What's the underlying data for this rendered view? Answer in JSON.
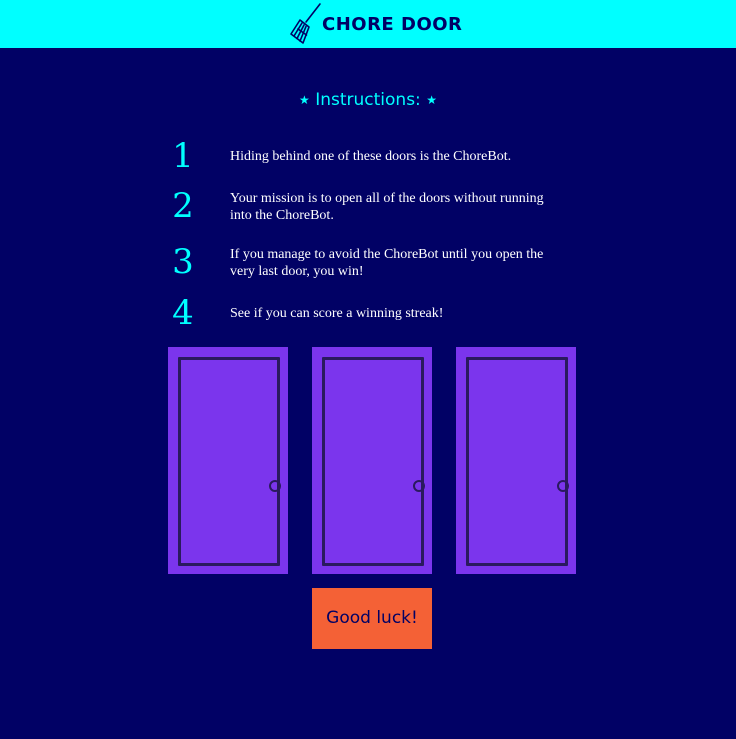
{
  "header": {
    "logo_icon": "broom-icon",
    "title": "CHORE DOOR",
    "background_color": "#00ffff"
  },
  "instructions": {
    "title": "Instructions:",
    "star_icon": "star-icon",
    "items": [
      {
        "number": "1",
        "text": "Hiding behind one of these doors is the ChoreBot."
      },
      {
        "number": "2",
        "text": "Your mission is to open all of the doors without running into the ChoreBot."
      },
      {
        "number": "3",
        "text": "If you manage to avoid the ChoreBot until you open the very last door, you win!"
      },
      {
        "number": "4",
        "text": "See if you can score a winning streak!"
      }
    ]
  },
  "doors": [
    {
      "state": "closed"
    },
    {
      "state": "closed"
    },
    {
      "state": "closed"
    }
  ],
  "start_button": {
    "label": "Good luck!"
  },
  "colors": {
    "page_background": "#010165",
    "accent": "#00ffff",
    "door": "#7b35ed",
    "button": "#f46136"
  }
}
